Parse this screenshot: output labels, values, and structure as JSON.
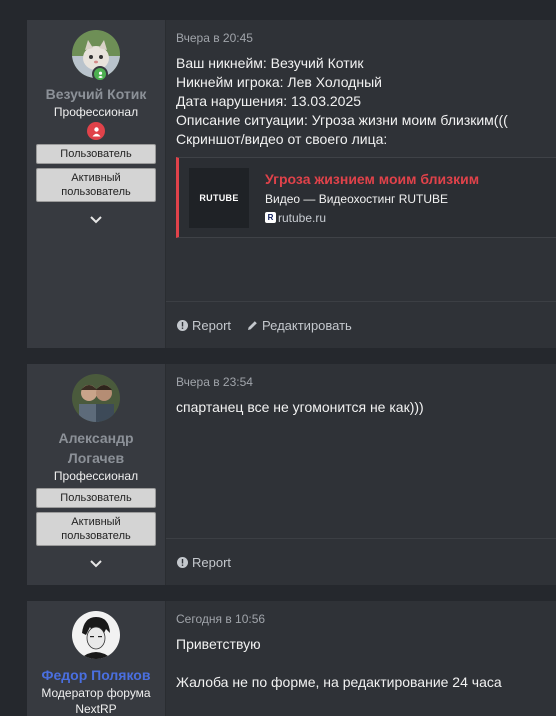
{
  "posts": [
    {
      "username": "Везучий Котик",
      "user_title": "Профессионал",
      "roles": [
        "Пользователь",
        "Активный пользователь"
      ],
      "time": "Вчера в 20:45",
      "lines": [
        "Ваш никнейм: Везучий Котик",
        "Никнейм игрока: Лев Холодный",
        "Дата нарушения: 13.03.2025",
        "Описание ситуации: Угроза жизни моим близким(((",
        "Скриншот/видео от своего лица:"
      ],
      "embed": {
        "thumb_text": "RUTUBE",
        "title": "Угроза жизнием моим близким",
        "subtitle": "Видео — Видеохостинг RUTUBE",
        "domain": "rutube.ru",
        "favicon_letter": "R"
      },
      "actions": {
        "report": "Report",
        "edit": "Редактировать"
      }
    },
    {
      "username": "Александр Логачев",
      "user_title": "Профессионал",
      "roles": [
        "Пользователь",
        "Активный пользователь"
      ],
      "time": "Вчера в 23:54",
      "lines": [
        "спартанец все не угомонится не как)))"
      ],
      "actions": {
        "report": "Report"
      }
    },
    {
      "username": "Федор Поляков",
      "user_title": "Модератор форума NextRP",
      "time": "Сегодня в 10:56",
      "lines": [
        "Приветствую",
        "",
        "Жалоба не по форме, на редактирование 24 часа"
      ]
    }
  ],
  "colors": {
    "page_bg": "#25282d",
    "post_bg": "#2f3237",
    "user_col_bg": "#373a40",
    "accent_red": "#e0424a",
    "moderator_blue": "#4a6fe0",
    "online_green": "#4caf50"
  },
  "icons": [
    "online-dot-icon",
    "achievement-badge-icon",
    "chevron-down-icon",
    "report-icon",
    "edit-pencil-icon",
    "rutube-favicon-icon"
  ]
}
